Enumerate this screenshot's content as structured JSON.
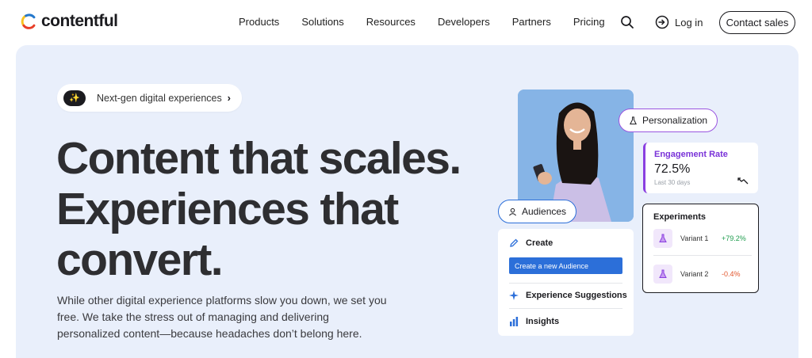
{
  "brand": {
    "name": "contentful"
  },
  "nav": {
    "items": [
      "Products",
      "Solutions",
      "Resources",
      "Developers",
      "Partners",
      "Pricing"
    ],
    "login": "Log in",
    "contact": "Contact sales"
  },
  "hero": {
    "pill": {
      "badge_icon": "sparkle-icon",
      "text": "Next-gen digital experiences"
    },
    "headline": [
      "Content that scales.",
      "Experiences that",
      "convert."
    ],
    "description": "While other digital experience platforms slow you down, we set you free. We take the stress out of managing and delivering personalized content—because headaches don’t belong here."
  },
  "visual": {
    "personalization_chip": "Personalization",
    "audiences_chip": "Audiences",
    "engagement": {
      "title": "Engagement Rate",
      "value": "72.5%",
      "period": "Last 30 days"
    },
    "experiments": {
      "title": "Experiments",
      "variants": [
        {
          "name": "Variant 1",
          "delta": "+79.2%",
          "trend": "positive"
        },
        {
          "name": "Variant 2",
          "delta": "-0.4%",
          "trend": "negative"
        }
      ]
    },
    "create_panel": {
      "create_label": "Create",
      "create_button": "Create a new Audience",
      "suggestions": "Experience Suggestions",
      "insights": "Insights"
    }
  },
  "colors": {
    "hero_bg": "#e9effb",
    "accent_blue": "#2c6fd9",
    "accent_purple": "#8a3fe0",
    "positive": "#1f9d4e",
    "negative": "#e2572e"
  }
}
